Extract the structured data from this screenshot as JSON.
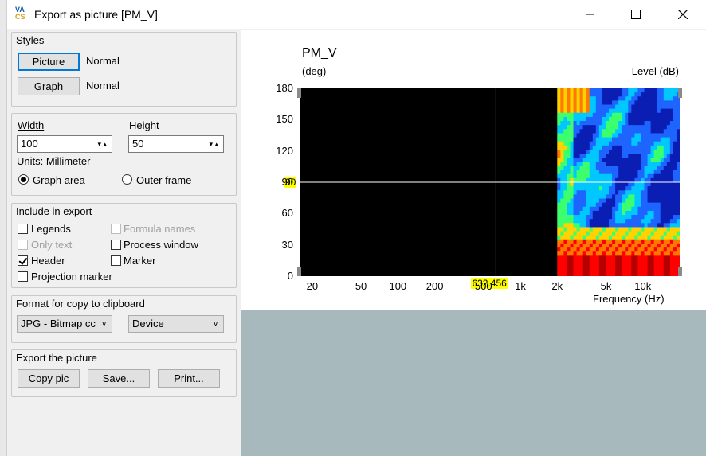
{
  "window": {
    "title": "Export as picture [PM_V]",
    "app_icon_top": "VA",
    "app_icon_bottom": "CS"
  },
  "styles": {
    "group_title": "Styles",
    "picture_label": "Picture",
    "picture_value": "Normal",
    "graph_label": "Graph",
    "graph_value": "Normal"
  },
  "size": {
    "width_label": "Width",
    "height_label": "Height",
    "width_value": "100",
    "height_value": "50",
    "units": "Units: Millimeter",
    "graph_area": "Graph area",
    "outer_frame": "Outer frame"
  },
  "include": {
    "group_title": "Include in export",
    "legends": "Legends",
    "formula_names": "Formula names",
    "only_text": "Only text",
    "process_window": "Process window",
    "header": "Header",
    "marker": "Marker",
    "projection_marker": "Projection marker"
  },
  "format": {
    "group_title": "Format for copy to clipboard",
    "format_value": "JPG - Bitmap cc",
    "device_value": "Device"
  },
  "export": {
    "group_title": "Export the picture",
    "copy_label": "Copy pic",
    "save_label": "Save...",
    "print_label": "Print..."
  },
  "chart_data": {
    "type": "heatmap",
    "title": "PM_V",
    "ylabel": "(deg)",
    "zlabel": "Level  (dB)",
    "xlabel": "Frequency  (Hz)",
    "yticks": [
      "180",
      "150",
      "120",
      "90",
      "60",
      "30",
      "0"
    ],
    "ylim": [
      0,
      180
    ],
    "xscale": "log",
    "xticks": [
      {
        "label": "20",
        "value": 20
      },
      {
        "label": "50",
        "value": 50
      },
      {
        "label": "100",
        "value": 100
      },
      {
        "label": "200",
        "value": 200
      },
      {
        "label": "500",
        "value": 500
      },
      {
        "label": "1k",
        "value": 1000
      },
      {
        "label": "2k",
        "value": 2000
      },
      {
        "label": "5k",
        "value": 5000
      },
      {
        "label": "10k",
        "value": 10000
      }
    ],
    "xlim": [
      16,
      20000
    ],
    "data_start_freq": 2000,
    "cursor_x": 632.456,
    "cursor_x_label": "632.456",
    "cursor_y": 90,
    "cursor_y_label": "90"
  },
  "colors": {
    "plot_bg": "#000000",
    "cursor_tag": "#ffff00",
    "dark_blue": "#0a1eb4",
    "blue": "#1e64ff",
    "cyan": "#00c8ff",
    "green": "#3cff6e",
    "yellow": "#ffd200",
    "orange": "#ff7800",
    "red": "#ff0000",
    "dark_red": "#b40000"
  }
}
